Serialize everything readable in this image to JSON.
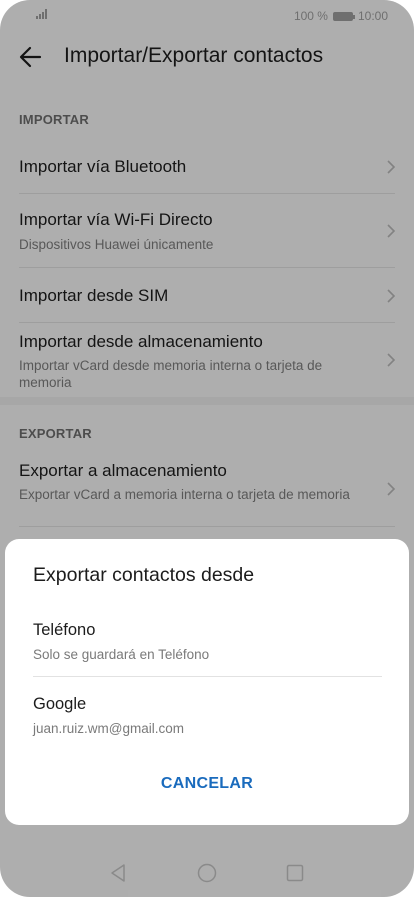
{
  "status_bar": {
    "battery_text": "100 %",
    "time": "10:00"
  },
  "header": {
    "title": "Importar/Exportar contactos"
  },
  "import_section": {
    "header": "IMPORTAR",
    "items": [
      {
        "title": "Importar vía Bluetooth",
        "subtitle": ""
      },
      {
        "title": "Importar vía Wi-Fi Directo",
        "subtitle": "Dispositivos Huawei únicamente"
      },
      {
        "title": "Importar desde SIM",
        "subtitle": ""
      },
      {
        "title": "Importar desde almacenamiento",
        "subtitle": "Importar vCard desde memoria interna o tarjeta de memoria"
      }
    ]
  },
  "export_section": {
    "header": "EXPORTAR",
    "items": [
      {
        "title": "Exportar a almacenamiento",
        "subtitle": "Exportar vCard a memoria interna o tarjeta de memoria"
      }
    ]
  },
  "dialog": {
    "title": "Exportar contactos desde",
    "options": [
      {
        "title": "Teléfono",
        "subtitle": "Solo se guardará en Teléfono"
      },
      {
        "title": "Google",
        "subtitle": "juan.ruiz.wm@gmail.com"
      }
    ],
    "cancel_label": "CANCELAR"
  },
  "colors": {
    "accent": "#1a6bbd",
    "background": "#f2f2f2",
    "scrim": "#000000"
  },
  "icons": {
    "back": "back-arrow-icon",
    "chevron": "chevron-right-icon",
    "nav_back": "triangle-back-icon",
    "nav_home": "circle-home-icon",
    "nav_recent": "square-recents-icon"
  }
}
